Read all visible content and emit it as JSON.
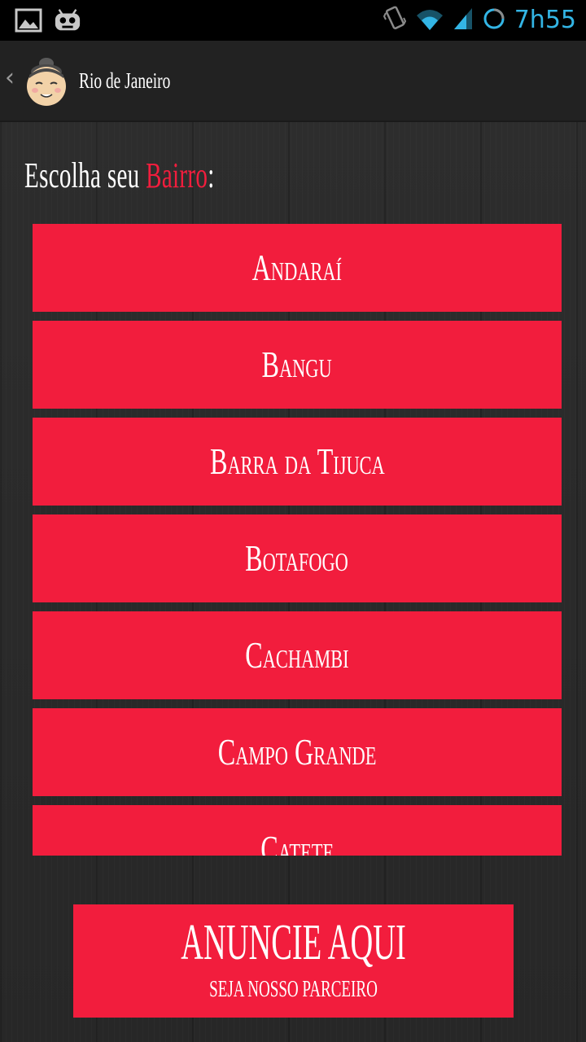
{
  "status_bar": {
    "time": "7h55",
    "left_icons": [
      "image-icon",
      "android-icon"
    ],
    "right_icons": [
      "vibrate-icon",
      "wifi-icon",
      "signal-icon",
      "sync-icon"
    ],
    "accent_color": "#33b5e5"
  },
  "action_bar": {
    "back_icon": "chevron-left-icon",
    "avatar_icon": "sumo-avatar-icon",
    "title": "Rio de Janeiro"
  },
  "heading": {
    "prefix": "Escolha seu ",
    "highlight": "Bairro",
    "suffix": ":"
  },
  "neighborhoods": [
    {
      "label": "Andaraí"
    },
    {
      "label": "Bangu"
    },
    {
      "label": "Barra da Tijuca"
    },
    {
      "label": "Botafogo"
    },
    {
      "label": "Cachambi"
    },
    {
      "label": "Campo Grande"
    },
    {
      "label": "Catete"
    }
  ],
  "ad_banner": {
    "title": "ANUNCIE AQUI",
    "subtitle": "SEJA NOSSO PARCEIRO"
  },
  "colors": {
    "accent_red": "#f21d3d",
    "background": "#2a2a2a",
    "action_bar": "#222222"
  }
}
